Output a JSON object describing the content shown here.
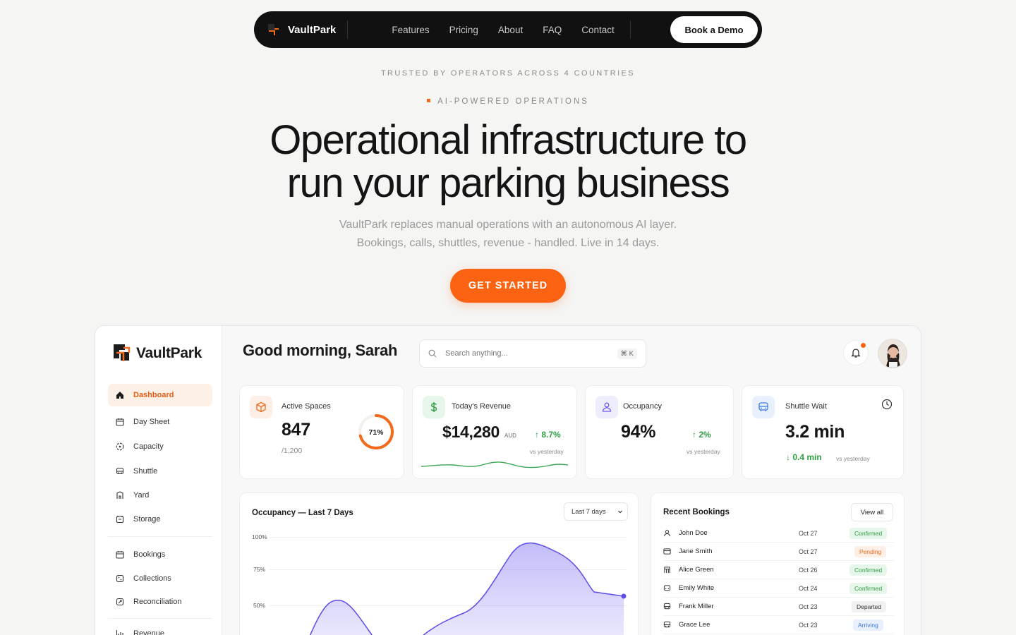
{
  "nav": {
    "brand": "VaultPark",
    "links": [
      "Features",
      "Pricing",
      "About",
      "FAQ",
      "Contact"
    ],
    "cta": "Book a Demo"
  },
  "trusted": "TRUSTED BY OPERATORS ACROSS 4 COUNTRIES",
  "eyebrow": "AI-POWERED OPERATIONS",
  "hero": {
    "line1": "Operational infrastructure to",
    "line2": "run your parking business"
  },
  "subtitle": {
    "line1": "VaultPark replaces manual operations with an autonomous AI layer.",
    "line2": "Bookings, calls, shuttles, revenue - handled. Live in 14 days."
  },
  "cta": "GET STARTED",
  "colors": {
    "accent": "#fb6312",
    "green": "#2f9e44",
    "purple": "#6d5ef0"
  },
  "dashboard": {
    "brand": "VaultPark",
    "greeting": "Good morning, Sarah",
    "search_placeholder": "Search anything...",
    "search_shortcut": "⌘ K",
    "sidebar": [
      {
        "label": "Dashboard",
        "icon": "home-icon",
        "active": true
      },
      {
        "label": "Day Sheet",
        "icon": "calendar-icon"
      },
      {
        "label": "Capacity",
        "icon": "gauge-icon"
      },
      {
        "label": "Shuttle",
        "icon": "bus-icon"
      },
      {
        "label": "Yard",
        "icon": "yard-icon"
      },
      {
        "label": "Storage",
        "icon": "storage-icon"
      },
      {
        "label": "Bookings",
        "icon": "calendar-icon"
      },
      {
        "label": "Collections",
        "icon": "collections-icon"
      },
      {
        "label": "Reconciliation",
        "icon": "reconcile-icon"
      },
      {
        "label": "Revenue",
        "icon": "chart-icon"
      }
    ],
    "kpis": {
      "spaces": {
        "label": "Active Spaces",
        "value": "847",
        "sub": "/1,200",
        "ring": "71%",
        "ring_fraction": 0.71
      },
      "revenue": {
        "label": "Today's Revenue",
        "value": "$14,280",
        "unit": "AUD",
        "delta": "8.7%",
        "vs": "vs yesterday"
      },
      "occupancy": {
        "label": "Occupancy",
        "value": "94%",
        "delta": "2%",
        "vs": "vs yesterday"
      },
      "shuttle": {
        "label": "Shuttle Wait",
        "value": "3.2 min",
        "delta": "0.4 min",
        "vs": "vs yesterday"
      }
    },
    "occupancy_chart": {
      "title": "Occupancy — Last 7 Days",
      "range": "Last 7 days",
      "ylabels": [
        "100%",
        "75%",
        "50%"
      ]
    },
    "bookings": {
      "title": "Recent Bookings",
      "view_all": "View all",
      "rows": [
        {
          "name": "John Doe",
          "date": "Oct 27",
          "status": "Confirmed",
          "icon": "user-icon"
        },
        {
          "name": "Jane Smith",
          "date": "Oct 27",
          "status": "Pending",
          "icon": "card-icon"
        },
        {
          "name": "Alice Green",
          "date": "Oct 26",
          "status": "Confirmed",
          "icon": "gate-icon"
        },
        {
          "name": "Emily White",
          "date": "Oct 24",
          "status": "Confirmed",
          "icon": "car-icon"
        },
        {
          "name": "Frank Miller",
          "date": "Oct 23",
          "status": "Departed",
          "icon": "bus-icon"
        },
        {
          "name": "Grace Lee",
          "date": "Oct 23",
          "status": "Arriving",
          "icon": "bus-icon"
        }
      ]
    }
  }
}
